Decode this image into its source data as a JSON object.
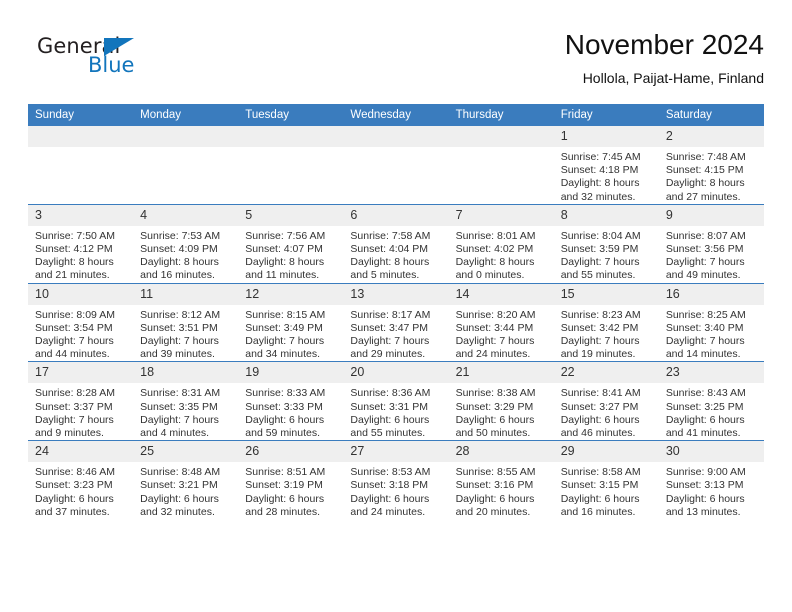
{
  "brand": {
    "name_part1": "General",
    "name_part2": "Blue",
    "triangle_icon": "triangle-icon",
    "accent_color": "#1275bc"
  },
  "header": {
    "title": "November 2024",
    "subtitle": "Hollola, Paijat-Hame, Finland"
  },
  "theme": {
    "header_blue": "#3a7cbe",
    "daynum_gray": "#efefef",
    "text": "#333333"
  },
  "weekday_headers": [
    "Sunday",
    "Monday",
    "Tuesday",
    "Wednesday",
    "Thursday",
    "Friday",
    "Saturday"
  ],
  "weeks": [
    [
      {
        "day": "",
        "lines": []
      },
      {
        "day": "",
        "lines": []
      },
      {
        "day": "",
        "lines": []
      },
      {
        "day": "",
        "lines": []
      },
      {
        "day": "",
        "lines": []
      },
      {
        "day": "1",
        "lines": [
          "Sunrise: 7:45 AM",
          "Sunset: 4:18 PM",
          "Daylight: 8 hours",
          "and 32 minutes."
        ]
      },
      {
        "day": "2",
        "lines": [
          "Sunrise: 7:48 AM",
          "Sunset: 4:15 PM",
          "Daylight: 8 hours",
          "and 27 minutes."
        ]
      }
    ],
    [
      {
        "day": "3",
        "lines": [
          "Sunrise: 7:50 AM",
          "Sunset: 4:12 PM",
          "Daylight: 8 hours",
          "and 21 minutes."
        ]
      },
      {
        "day": "4",
        "lines": [
          "Sunrise: 7:53 AM",
          "Sunset: 4:09 PM",
          "Daylight: 8 hours",
          "and 16 minutes."
        ]
      },
      {
        "day": "5",
        "lines": [
          "Sunrise: 7:56 AM",
          "Sunset: 4:07 PM",
          "Daylight: 8 hours",
          "and 11 minutes."
        ]
      },
      {
        "day": "6",
        "lines": [
          "Sunrise: 7:58 AM",
          "Sunset: 4:04 PM",
          "Daylight: 8 hours",
          "and 5 minutes."
        ]
      },
      {
        "day": "7",
        "lines": [
          "Sunrise: 8:01 AM",
          "Sunset: 4:02 PM",
          "Daylight: 8 hours",
          "and 0 minutes."
        ]
      },
      {
        "day": "8",
        "lines": [
          "Sunrise: 8:04 AM",
          "Sunset: 3:59 PM",
          "Daylight: 7 hours",
          "and 55 minutes."
        ]
      },
      {
        "day": "9",
        "lines": [
          "Sunrise: 8:07 AM",
          "Sunset: 3:56 PM",
          "Daylight: 7 hours",
          "and 49 minutes."
        ]
      }
    ],
    [
      {
        "day": "10",
        "lines": [
          "Sunrise: 8:09 AM",
          "Sunset: 3:54 PM",
          "Daylight: 7 hours",
          "and 44 minutes."
        ]
      },
      {
        "day": "11",
        "lines": [
          "Sunrise: 8:12 AM",
          "Sunset: 3:51 PM",
          "Daylight: 7 hours",
          "and 39 minutes."
        ]
      },
      {
        "day": "12",
        "lines": [
          "Sunrise: 8:15 AM",
          "Sunset: 3:49 PM",
          "Daylight: 7 hours",
          "and 34 minutes."
        ]
      },
      {
        "day": "13",
        "lines": [
          "Sunrise: 8:17 AM",
          "Sunset: 3:47 PM",
          "Daylight: 7 hours",
          "and 29 minutes."
        ]
      },
      {
        "day": "14",
        "lines": [
          "Sunrise: 8:20 AM",
          "Sunset: 3:44 PM",
          "Daylight: 7 hours",
          "and 24 minutes."
        ]
      },
      {
        "day": "15",
        "lines": [
          "Sunrise: 8:23 AM",
          "Sunset: 3:42 PM",
          "Daylight: 7 hours",
          "and 19 minutes."
        ]
      },
      {
        "day": "16",
        "lines": [
          "Sunrise: 8:25 AM",
          "Sunset: 3:40 PM",
          "Daylight: 7 hours",
          "and 14 minutes."
        ]
      }
    ],
    [
      {
        "day": "17",
        "lines": [
          "Sunrise: 8:28 AM",
          "Sunset: 3:37 PM",
          "Daylight: 7 hours",
          "and 9 minutes."
        ]
      },
      {
        "day": "18",
        "lines": [
          "Sunrise: 8:31 AM",
          "Sunset: 3:35 PM",
          "Daylight: 7 hours",
          "and 4 minutes."
        ]
      },
      {
        "day": "19",
        "lines": [
          "Sunrise: 8:33 AM",
          "Sunset: 3:33 PM",
          "Daylight: 6 hours",
          "and 59 minutes."
        ]
      },
      {
        "day": "20",
        "lines": [
          "Sunrise: 8:36 AM",
          "Sunset: 3:31 PM",
          "Daylight: 6 hours",
          "and 55 minutes."
        ]
      },
      {
        "day": "21",
        "lines": [
          "Sunrise: 8:38 AM",
          "Sunset: 3:29 PM",
          "Daylight: 6 hours",
          "and 50 minutes."
        ]
      },
      {
        "day": "22",
        "lines": [
          "Sunrise: 8:41 AM",
          "Sunset: 3:27 PM",
          "Daylight: 6 hours",
          "and 46 minutes."
        ]
      },
      {
        "day": "23",
        "lines": [
          "Sunrise: 8:43 AM",
          "Sunset: 3:25 PM",
          "Daylight: 6 hours",
          "and 41 minutes."
        ]
      }
    ],
    [
      {
        "day": "24",
        "lines": [
          "Sunrise: 8:46 AM",
          "Sunset: 3:23 PM",
          "Daylight: 6 hours",
          "and 37 minutes."
        ]
      },
      {
        "day": "25",
        "lines": [
          "Sunrise: 8:48 AM",
          "Sunset: 3:21 PM",
          "Daylight: 6 hours",
          "and 32 minutes."
        ]
      },
      {
        "day": "26",
        "lines": [
          "Sunrise: 8:51 AM",
          "Sunset: 3:19 PM",
          "Daylight: 6 hours",
          "and 28 minutes."
        ]
      },
      {
        "day": "27",
        "lines": [
          "Sunrise: 8:53 AM",
          "Sunset: 3:18 PM",
          "Daylight: 6 hours",
          "and 24 minutes."
        ]
      },
      {
        "day": "28",
        "lines": [
          "Sunrise: 8:55 AM",
          "Sunset: 3:16 PM",
          "Daylight: 6 hours",
          "and 20 minutes."
        ]
      },
      {
        "day": "29",
        "lines": [
          "Sunrise: 8:58 AM",
          "Sunset: 3:15 PM",
          "Daylight: 6 hours",
          "and 16 minutes."
        ]
      },
      {
        "day": "30",
        "lines": [
          "Sunrise: 9:00 AM",
          "Sunset: 3:13 PM",
          "Daylight: 6 hours",
          "and 13 minutes."
        ]
      }
    ]
  ]
}
